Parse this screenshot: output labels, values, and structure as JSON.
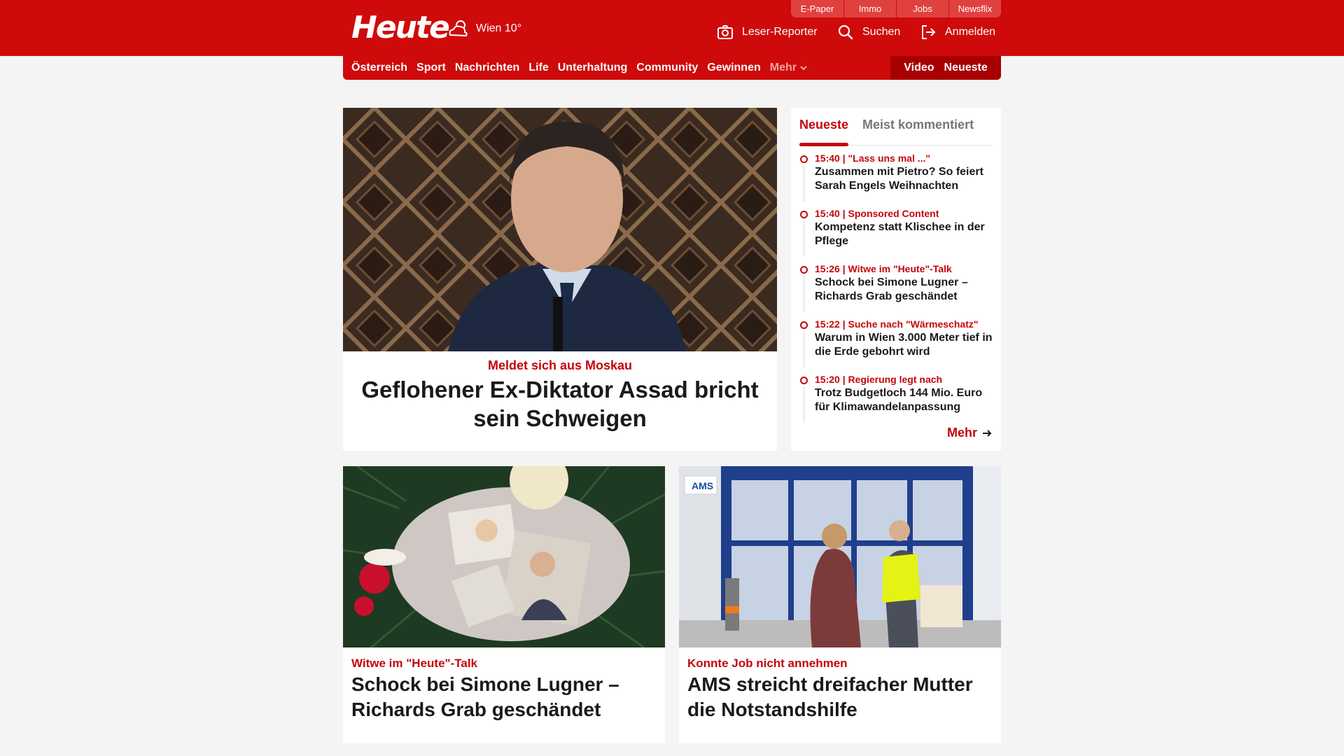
{
  "header": {
    "logo": "Heute",
    "weather": "Wien 10°",
    "top_links": [
      "E-Paper",
      "Immo",
      "Jobs",
      "Newsflix"
    ],
    "leser_reporter": "Leser-Reporter",
    "suchen": "Suchen",
    "anmelden": "Anmelden"
  },
  "nav": {
    "items": [
      "Österreich",
      "Sport",
      "Nachrichten",
      "Life",
      "Unterhaltung",
      "Community",
      "Gewinnen"
    ],
    "mehr": "Mehr",
    "video": "Video",
    "neueste": "Neueste"
  },
  "hero": {
    "kicker": "Meldet sich aus Moskau",
    "title": "Geflohener Ex-Diktator Assad bricht sein Schweigen"
  },
  "sidebar": {
    "tabs": [
      "Neueste",
      "Meist kommentiert"
    ],
    "items": [
      {
        "meta": "15:40 | \"Lass uns mal ...\"",
        "title": "Zusammen mit Pietro? So feiert Sarah Engels Weihnachten"
      },
      {
        "meta": "15:40 | Sponsored Content",
        "title": "Kompetenz statt Klischee in der Pflege"
      },
      {
        "meta": "15:26 | Witwe im \"Heute\"-Talk",
        "title": "Schock bei Simone Lugner – Richards Grab geschändet"
      },
      {
        "meta": "15:22 | Suche nach \"Wärmeschatz\"",
        "title": "Warum in Wien 3.000 Meter tief in die Erde gebohrt wird"
      },
      {
        "meta": "15:20 | Regierung legt nach",
        "title": "Trotz Budgetloch 144 Mio. Euro für Klimawandelanpassung"
      }
    ],
    "more": "Mehr"
  },
  "cards": [
    {
      "kicker": "Witwe im \"Heute\"-Talk",
      "title": "Schock bei Simone Lugner – Richards Grab geschändet"
    },
    {
      "kicker": "Konnte Job nicht annehmen",
      "title": "AMS streicht dreifacher Mutter die Notstandshilfe"
    }
  ],
  "colors": {
    "brand": "#cf0a0a",
    "accent": "#c4050b"
  }
}
